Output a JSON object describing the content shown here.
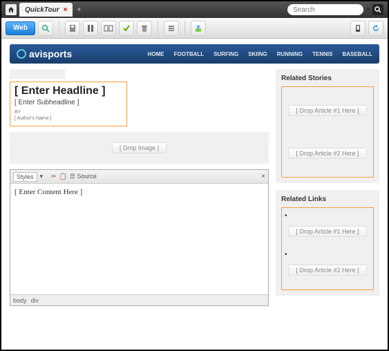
{
  "top": {
    "tab": "QuickTour",
    "close": "×",
    "plus": "+",
    "search_placeholder": "Search"
  },
  "toolbar": {
    "web": "Web"
  },
  "nav": {
    "brand": "avisports",
    "items": [
      "HOME",
      "FOOTBALL",
      "SURFING",
      "SKIING",
      "RUNNING",
      "TENNIS",
      "BASEBALL"
    ]
  },
  "article": {
    "headline": "[ Enter Headline ]",
    "subhead": "[ Enter Subheadline ]",
    "by": "BY",
    "author": "[ Author's Name ]",
    "drop_image": "[ Drop Image ]"
  },
  "editor": {
    "styles": "Styles",
    "source": "Source",
    "body_placeholder": "[ Enter Content Here ]",
    "path1": "body",
    "path2": "div"
  },
  "side": {
    "stories_title": "Related Stories",
    "links_title": "Related Links",
    "drop1": "[ Drop Article #1 Here ]",
    "drop2": "[ Drop Article #2 Here ]"
  }
}
